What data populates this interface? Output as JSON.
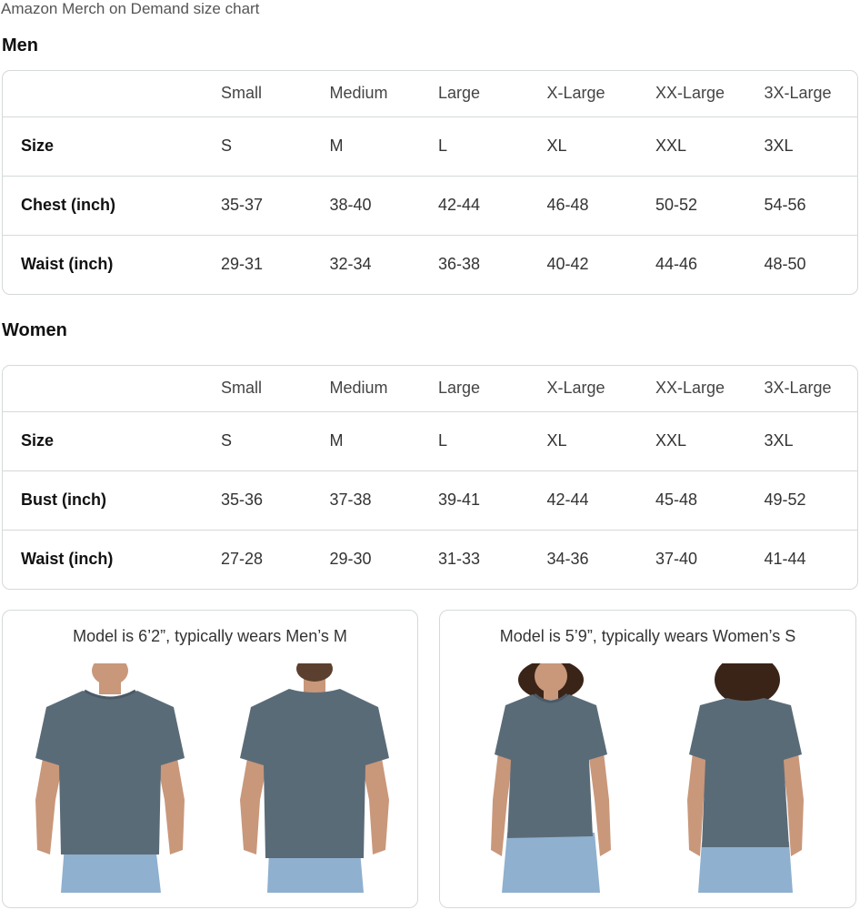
{
  "page": {
    "title": "Amazon Merch on Demand size chart"
  },
  "men": {
    "heading": "Men",
    "columns": [
      "Small",
      "Medium",
      "Large",
      "X-Large",
      "XX-Large",
      "3X-Large"
    ],
    "rows": [
      {
        "label": "Size",
        "values": [
          "S",
          "M",
          "L",
          "XL",
          "XXL",
          "3XL"
        ]
      },
      {
        "label": "Chest (inch)",
        "values": [
          "35-37",
          "38-40",
          "42-44",
          "46-48",
          "50-52",
          "54-56"
        ]
      },
      {
        "label": "Waist (inch)",
        "values": [
          "29-31",
          "32-34",
          "36-38",
          "40-42",
          "44-46",
          "48-50"
        ]
      }
    ],
    "model_caption": "Model is 6’2”, typically wears Men’s M"
  },
  "women": {
    "heading": "Women",
    "columns": [
      "Small",
      "Medium",
      "Large",
      "X-Large",
      "XX-Large",
      "3X-Large"
    ],
    "rows": [
      {
        "label": "Size",
        "values": [
          "S",
          "M",
          "L",
          "XL",
          "XXL",
          "3XL"
        ]
      },
      {
        "label": "Bust (inch)",
        "values": [
          "35-36",
          "37-38",
          "39-41",
          "42-44",
          "45-48",
          "49-52"
        ]
      },
      {
        "label": "Waist (inch)",
        "values": [
          "27-28",
          "29-30",
          "31-33",
          "34-36",
          "37-40",
          "41-44"
        ]
      }
    ],
    "model_caption": "Model is 5’9”, typically wears Women’s S"
  },
  "colors": {
    "shirt": "#5a6b78",
    "shirt_shadow": "#4b5a66",
    "skin": "#c9977a",
    "denim": "#8fb0cf",
    "hair_women": "#3a2418",
    "hair_men": "#5b4030",
    "border": "#d5d9d9"
  }
}
